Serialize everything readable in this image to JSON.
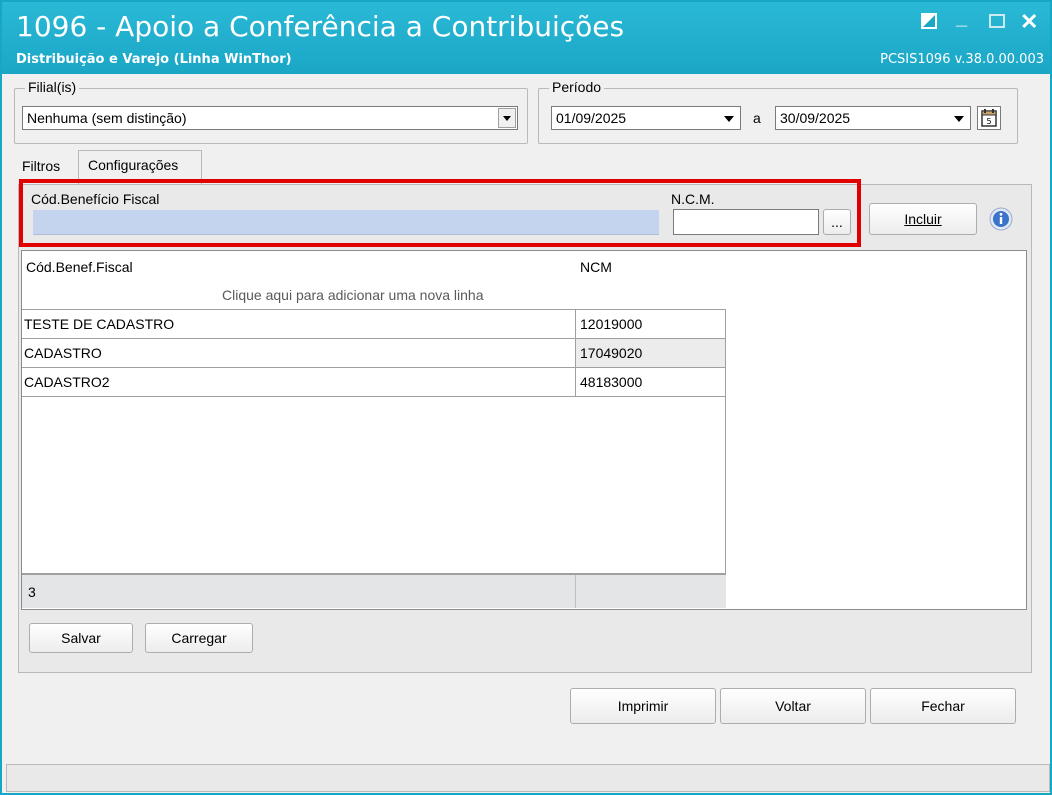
{
  "window": {
    "title": "1096 - Apoio a Conferência a Contribuições",
    "subtitle": "Distribuição e Varejo (Linha WinThor)",
    "version": "PCSIS1096  v.38.0.00.003",
    "accent_color": "#1ba6c6",
    "controls": [
      "restore-icon",
      "minimize-icon",
      "maximize-icon",
      "close-icon"
    ]
  },
  "filial": {
    "legend": "Filial(is)",
    "value": "Nenhuma (sem distinção)"
  },
  "periodo": {
    "legend": "Período",
    "start": "01/09/2025",
    "separator": "a",
    "end": "30/09/2025",
    "calendar_icon": "calendar-icon"
  },
  "tabs": [
    {
      "label": "Filtros",
      "active": false
    },
    {
      "label": "Configurações",
      "active": true
    }
  ],
  "form": {
    "cod_label": "Cód.Benefício Fiscal",
    "ncm_label": "N.C.M.",
    "ellipsis_label": "...",
    "incluir_label": "Incluir",
    "info_icon": "info-icon",
    "highlight_color": "#e00000"
  },
  "grid": {
    "headers": [
      "Cód.Benef.Fiscal",
      "NCM"
    ],
    "new_row_hint": "Clique aqui para adicionar uma nova linha",
    "rows": [
      {
        "cod": "TESTE DE CADASTRO",
        "ncm": "12019000"
      },
      {
        "cod": "CADASTRO",
        "ncm": "17049020"
      },
      {
        "cod": "CADASTRO2",
        "ncm": "48183000"
      }
    ],
    "footer_count": "3"
  },
  "actions": {
    "salvar": "Salvar",
    "carregar": "Carregar",
    "imprimir": "Imprimir",
    "voltar": "Voltar",
    "fechar": "Fechar"
  }
}
